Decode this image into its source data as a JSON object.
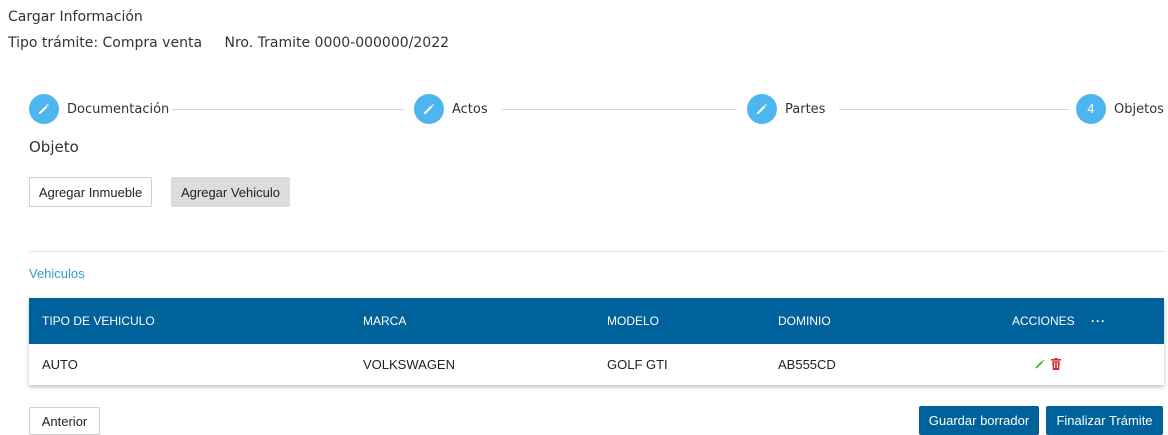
{
  "header": {
    "title": "Cargar Información",
    "tipo_tramite": "Tipo trámite: Compra venta",
    "nro_tramite": "Nro. Tramite 0000-000000/2022"
  },
  "stepper": {
    "steps": [
      {
        "label": "Documentación",
        "state": "done"
      },
      {
        "label": "Actos",
        "state": "done"
      },
      {
        "label": "Partes",
        "state": "done"
      },
      {
        "label": "Objetos",
        "state": "current",
        "number": "4"
      }
    ]
  },
  "section": {
    "title": "Objeto"
  },
  "buttons": {
    "agregar_inmueble": "Agregar Inmueble",
    "agregar_vehiculo": "Agregar Vehiculo",
    "anterior": "Anterior",
    "guardar_borrador": "Guardar borrador",
    "finalizar_tramite": "Finalizar Trámite"
  },
  "vehiculos": {
    "label": "Vehiculos",
    "columns": [
      "TIPO DE VEHICULO",
      "MARCA",
      "MODELO",
      "DOMINIO",
      "ACCIONES"
    ],
    "more_label": "···",
    "rows": [
      {
        "tipo": "AUTO",
        "marca": "VOLKSWAGEN",
        "modelo": "GOLF GTI",
        "dominio": "AB555CD"
      }
    ]
  },
  "colors": {
    "accent": "#4db6f0",
    "primary": "#00629a",
    "link": "#2a9fd6",
    "edit_icon": "#3cb043",
    "delete_icon": "#e0262b"
  },
  "icons": {
    "step_done": "pencil-icon",
    "edit": "pencil-icon",
    "delete": "trash-icon",
    "more": "ellipsis-icon"
  }
}
